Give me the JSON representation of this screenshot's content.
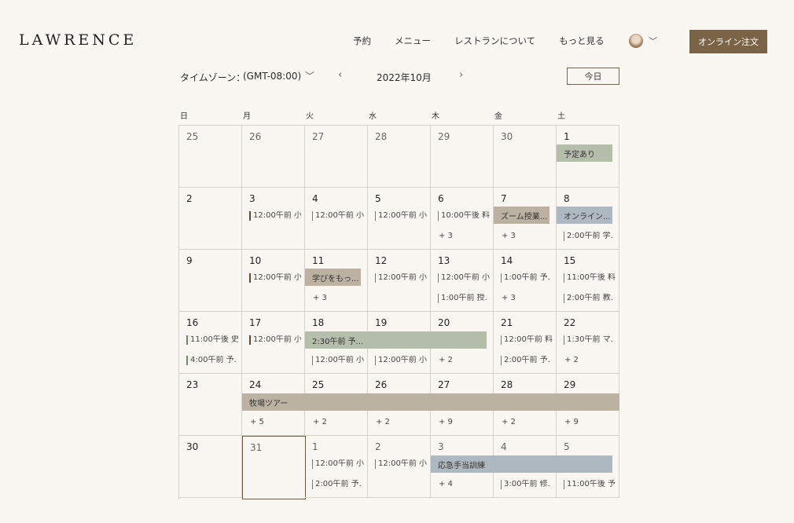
{
  "header": {
    "logo": "LAWRENCE",
    "nav": [
      "予約",
      "メニュー",
      "レストランについて",
      "もっと見る"
    ],
    "order_button": "オンライン注文"
  },
  "toolbar": {
    "timezone_label": "タイムゾーン：",
    "timezone_value": "(GMT-08:00)",
    "month": "2022年10月",
    "today_button": "今日"
  },
  "weekdays": [
    "日",
    "月",
    "火",
    "水",
    "木",
    "金",
    "土"
  ],
  "calendar": {
    "weeks": [
      [
        {
          "day": "25",
          "events": [],
          "more": ""
        },
        {
          "day": "26",
          "events": [],
          "more": ""
        },
        {
          "day": "27",
          "events": [],
          "more": ""
        },
        {
          "day": "28",
          "events": [],
          "more": ""
        },
        {
          "day": "29",
          "events": [],
          "more": ""
        },
        {
          "day": "30",
          "events": [],
          "more": ""
        },
        {
          "day": "1",
          "events": [],
          "more": ""
        }
      ],
      [
        {
          "day": "2",
          "events": [],
          "more": ""
        },
        {
          "day": "3",
          "events": [
            "12:00午前 小"
          ],
          "more": ""
        },
        {
          "day": "4",
          "events": [
            "12:00午前 小"
          ],
          "more": ""
        },
        {
          "day": "5",
          "events": [
            "12:00午前 小"
          ],
          "more": ""
        },
        {
          "day": "6",
          "events": [
            "10:00午後 料"
          ],
          "more": "+ 3"
        },
        {
          "day": "7",
          "events": [],
          "more": "+ 3"
        },
        {
          "day": "8",
          "events": [
            "",
            "2:00午前 学."
          ],
          "more": ""
        }
      ],
      [
        {
          "day": "9",
          "events": [],
          "more": ""
        },
        {
          "day": "10",
          "events": [
            "12:00午前 小"
          ],
          "more": ""
        },
        {
          "day": "11",
          "events": [],
          "more": "+ 3"
        },
        {
          "day": "12",
          "events": [
            "12:00午前 小"
          ],
          "more": ""
        },
        {
          "day": "13",
          "events": [
            "12:00午前 小",
            "1:00午前 授."
          ],
          "more": ""
        },
        {
          "day": "14",
          "events": [
            "1:00午前 予."
          ],
          "more": "+ 3"
        },
        {
          "day": "15",
          "events": [
            "11:00午後 料",
            "2:00午前 教."
          ],
          "more": ""
        }
      ],
      [
        {
          "day": "16",
          "events": [
            "11:00午後 史",
            "4:00午前 予."
          ],
          "more": ""
        },
        {
          "day": "17",
          "events": [
            "12:00午前 小"
          ],
          "more": ""
        },
        {
          "day": "18",
          "events": [
            "",
            "12:00午前 小"
          ],
          "more": ""
        },
        {
          "day": "19",
          "events": [
            "",
            "12:00午前 小"
          ],
          "more": ""
        },
        {
          "day": "20",
          "events": [],
          "more": "+ 2"
        },
        {
          "day": "21",
          "events": [
            "12:00午前 料",
            "2:00午前 予."
          ],
          "more": ""
        },
        {
          "day": "22",
          "events": [
            "1:30午前 マ."
          ],
          "more": "+ 2"
        }
      ],
      [
        {
          "day": "23",
          "events": [],
          "more": ""
        },
        {
          "day": "24",
          "events": [],
          "more": "+ 5"
        },
        {
          "day": "25",
          "events": [],
          "more": "+ 2"
        },
        {
          "day": "26",
          "events": [],
          "more": "+ 2"
        },
        {
          "day": "27",
          "events": [],
          "more": "+ 9"
        },
        {
          "day": "28",
          "events": [],
          "more": "+ 2"
        },
        {
          "day": "29",
          "events": [],
          "more": "+ 9"
        }
      ],
      [
        {
          "day": "30",
          "events": [],
          "more": ""
        },
        {
          "day": "31",
          "events": [],
          "more": ""
        },
        {
          "day": "1",
          "events": [
            "12:00午前 小",
            "2:00午前 予."
          ],
          "more": ""
        },
        {
          "day": "2",
          "events": [
            "12:00午前 小"
          ],
          "more": ""
        },
        {
          "day": "3",
          "events": [],
          "more": "+ 4"
        },
        {
          "day": "4",
          "events": [
            "",
            "3:00午前 修."
          ],
          "more": ""
        },
        {
          "day": "5",
          "events": [
            "",
            "11:00午後 予"
          ],
          "more": ""
        }
      ]
    ],
    "bars": {
      "oct1": "予定あり",
      "oct7": "ズーム授業...",
      "oct8": "オンライン...",
      "oct11": "学びをもっ...",
      "oct18": "2:30午前 予...",
      "oct24": "牧場ツアー",
      "nov3": "応急手当訓練"
    }
  },
  "colors": {
    "accent": "#7a6446",
    "bar_sage": "#b5bdab",
    "bar_tan": "#bcb2a2",
    "bar_blue": "#aeb8c1"
  }
}
